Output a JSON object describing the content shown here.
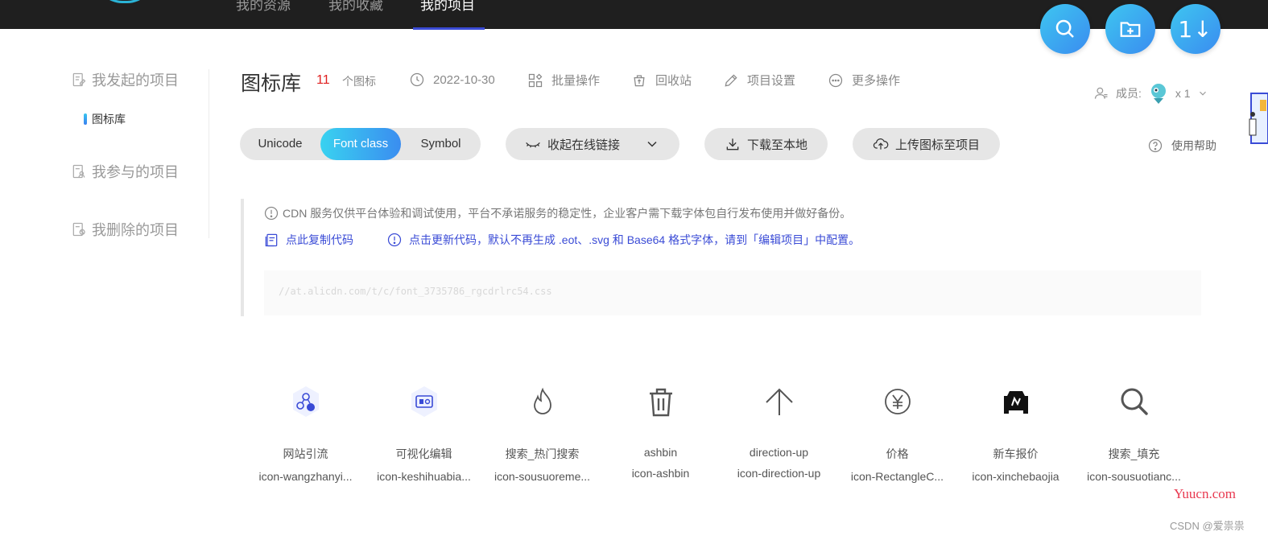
{
  "topnav": {
    "items": [
      {
        "label": "我的资源"
      },
      {
        "label": "我的收藏"
      },
      {
        "label": "我的项目",
        "active": true
      }
    ]
  },
  "fabs": [
    {
      "icon": "search-icon"
    },
    {
      "icon": "add-folder-icon"
    },
    {
      "icon": "sort-icon",
      "text": "1↓"
    }
  ],
  "sidebar": {
    "groups": [
      {
        "label": "我发起的项目",
        "icon": "edit-doc-icon",
        "children": [
          {
            "label": "图标库"
          }
        ]
      },
      {
        "label": "我参与的项目",
        "icon": "user-doc-icon"
      },
      {
        "label": "我删除的项目",
        "icon": "deleted-doc-icon"
      }
    ]
  },
  "header": {
    "title": "图标库",
    "icon_count": "11",
    "count_unit": "个图标",
    "date": "2022-10-30",
    "batch": "批量操作",
    "recycle": "回收站",
    "settings": "项目设置",
    "more": "更多操作",
    "members_label": "成员:",
    "members_count": "x 1"
  },
  "toolbar": {
    "tabs": [
      "Unicode",
      "Font class",
      "Symbol"
    ],
    "active_tab": "Font class",
    "collapse_link": "收起在线链接",
    "download": "下载至本地",
    "upload": "上传图标至项目",
    "help": "使用帮助"
  },
  "notice": {
    "warning": "CDN 服务仅供平台体验和调试使用，平台不承诺服务的稳定性，企业客户需下载字体包自行发布使用并做好备份。",
    "copy_code": "点此复制代码",
    "update_code": "点击更新代码，默认不再生成 .eot、.svg 和 Base64 格式字体，请到「编辑项目」中配置。",
    "code": "//at.alicdn.com/t/c/font_3735786_rgcdrlrc54.css"
  },
  "icons": [
    {
      "name": "网站引流",
      "class": "icon-wangzhanyi...",
      "glyph": "network-icon"
    },
    {
      "name": "可视化编辑",
      "class": "icon-keshihuabia...",
      "glyph": "visual-edit-icon"
    },
    {
      "name": "搜索_热门搜索",
      "class": "icon-sousuoreme...",
      "glyph": "fire-icon"
    },
    {
      "name": "ashbin",
      "class": "icon-ashbin",
      "glyph": "trash-icon"
    },
    {
      "name": "direction-up",
      "class": "icon-direction-up",
      "glyph": "arrow-up-icon"
    },
    {
      "name": "价格",
      "class": "icon-RectangleC...",
      "glyph": "yen-icon"
    },
    {
      "name": "新车报价",
      "class": "icon-xinchebaojia",
      "glyph": "car-icon"
    },
    {
      "name": "搜索_填充",
      "class": "icon-sousuotianc...",
      "glyph": "search-icon"
    }
  ],
  "footer": {
    "watermark": "Yuucn.com",
    "credit": "CSDN @爱祟祟"
  },
  "colors": {
    "nav_bg": "#1f1f1f",
    "accent": "#3a4bd6",
    "gradient_start": "#39d2f0",
    "gradient_end": "#3a8df0",
    "count_red": "#e02020"
  }
}
